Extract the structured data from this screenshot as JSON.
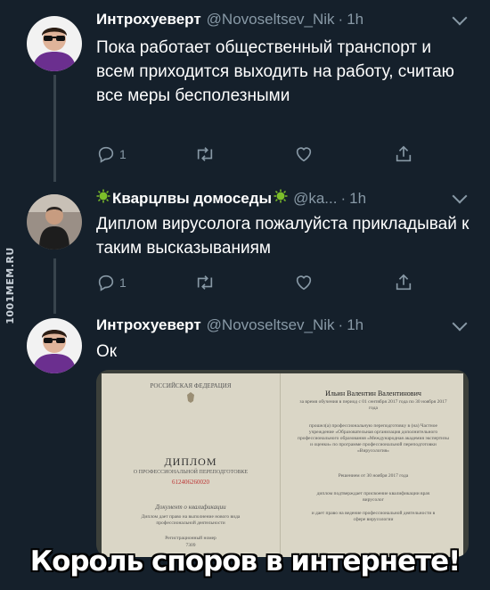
{
  "watermark": "1001MEM.RU",
  "tweets": [
    {
      "name": "Интрохуеверт",
      "handle": "@Novoseltsev_Nik",
      "dot": "·",
      "time": "1h",
      "text": "Пока работает общественный транспорт и всем приходится выходить на работу, считаю все меры бесполезными",
      "replies": "1",
      "retweets": "",
      "likes": ""
    },
    {
      "name": "Кварцлвы домоседы",
      "handle": "@ka...",
      "dot": "·",
      "time": "1h",
      "text": "Диплом вирусолога пожалуйста прикладывай к таким высказываниям",
      "replies": "1",
      "retweets": "",
      "likes": ""
    },
    {
      "name": "Интрохуеверт",
      "handle": "@Novoseltsev_Nik",
      "dot": "·",
      "time": "1h",
      "text": "Ок"
    }
  ],
  "diploma": {
    "country": "РОССИЙСКАЯ ФЕДЕРАЦИЯ",
    "title": "ДИПЛОМ",
    "subtitle": "О ПРОФЕССИОНАЛЬНОЙ ПЕРЕПОДГОТОВКЕ",
    "serial": "612406260020",
    "doc_note": "Документ о квалификации",
    "rights": "Диплом дает право на выполнение нового вида профессиональной деятельности",
    "reg_label": "Регистрационный номер",
    "reg_number": "7309",
    "holder": "Ильин Валентин Валентинович",
    "period": "за время обучения в период с 01 сентября 2017 года по 30 ноября 2017 года",
    "program": "прошел(а) профессиональную переподготовку в (на) Частное учреждение «Образовательная организация дополнительного профессионального образования «Международная академия экспертизы и оценки» по программе профессиональной переподготовки «Вирусология»",
    "decision": "Решением от 30 ноября 2017 года",
    "confirm": "диплом подтверждает присвоение квалификации врач вирусолог",
    "grants": "и дает право на ведение профессиональной деятельности в сфере вирусологии"
  },
  "caption": "Король споров в интернете!",
  "colors": {
    "background": "#15202b",
    "secondary_text": "#8899a6",
    "caption_outline": "#000000"
  }
}
